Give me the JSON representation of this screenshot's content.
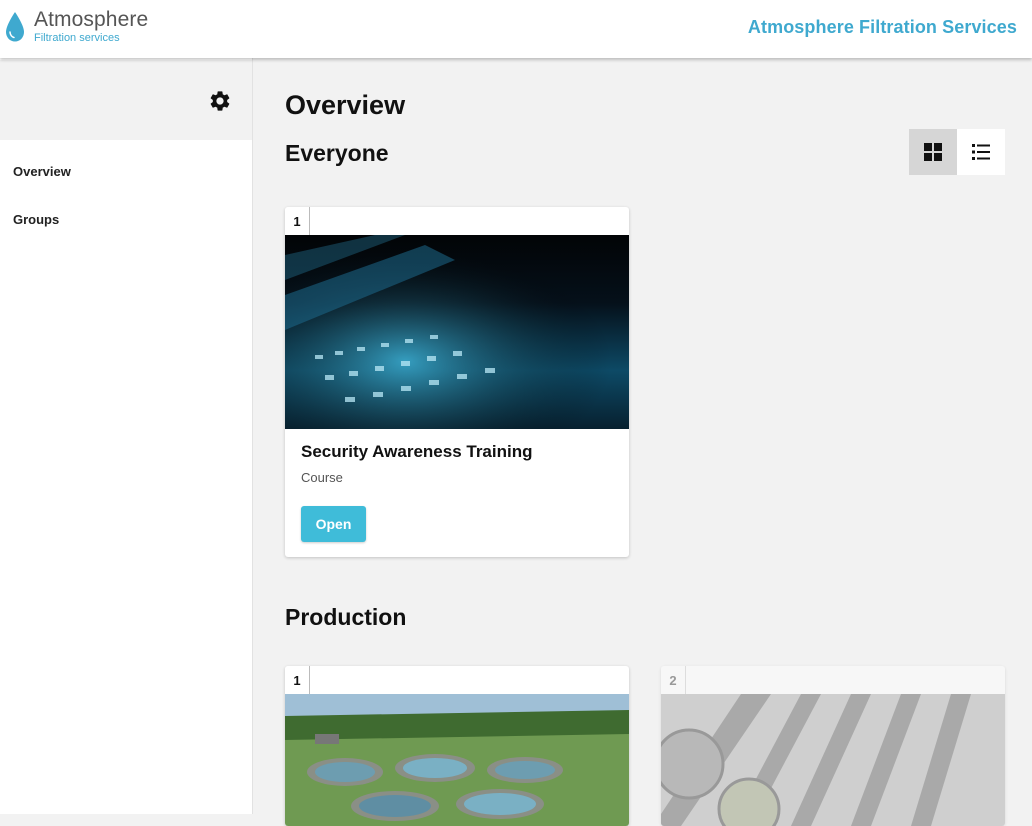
{
  "header": {
    "logo_name": "Atmosphere",
    "logo_tagline": "Filtration services",
    "organization": "Atmosphere Filtration Services"
  },
  "sidebar": {
    "settings_icon": "gear-icon",
    "items": [
      {
        "label": "Overview"
      },
      {
        "label": "Groups"
      }
    ]
  },
  "main": {
    "title": "Overview",
    "view_toggle": {
      "active": "grid",
      "options": [
        "grid-icon",
        "list-icon"
      ]
    },
    "sections": [
      {
        "title": "Everyone",
        "cards": [
          {
            "number": "1",
            "title": "Security Awareness Training",
            "type": "Course",
            "button": "Open",
            "image": "laptop-keyboard-photo"
          }
        ]
      },
      {
        "title": "Production",
        "cards": [
          {
            "number": "1",
            "image": "water-treatment-aerial-photo"
          },
          {
            "number": "2",
            "image": "filtration-tanks-aerial-photo",
            "locked": true
          }
        ]
      }
    ]
  },
  "colors": {
    "accent": "#3fa9cf",
    "button": "#3fbcd9",
    "background": "#f2f2f2"
  }
}
